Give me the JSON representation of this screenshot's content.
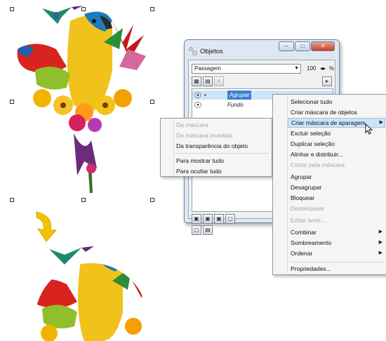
{
  "docker": {
    "title": "Objetos",
    "page_select": "Passagem",
    "opacity": "100",
    "percent": "%",
    "layers": [
      {
        "name": "Agrupar",
        "selected": true
      },
      {
        "name": "Fundo",
        "selected": false
      }
    ]
  },
  "context_menu": {
    "items": [
      {
        "label": "Selecionar tudo",
        "disabled": false
      },
      {
        "label": "Criar máscara de objetos",
        "disabled": false
      },
      {
        "label": "Criar máscara de aparagem",
        "disabled": false,
        "highlighted": true,
        "submenu": true
      },
      {
        "label": "Excluir seleção",
        "disabled": false
      },
      {
        "label": "Duplicar seleção",
        "disabled": false
      },
      {
        "label": "Alinhar e distribuir...",
        "disabled": false
      },
      {
        "label": "Cortar pela máscara",
        "disabled": true
      },
      {
        "label": "Agrupar",
        "disabled": false
      },
      {
        "label": "Desagrupar",
        "disabled": false
      },
      {
        "label": "Bloquear",
        "disabled": false
      },
      {
        "label": "Desbloquear",
        "disabled": true
      },
      {
        "label": "Editar lente...",
        "disabled": true
      },
      {
        "label": "Combinar",
        "disabled": false,
        "submenu": true
      },
      {
        "label": "Sombreamento",
        "disabled": false,
        "submenu": true
      },
      {
        "label": "Ordenar",
        "disabled": false,
        "submenu": true
      },
      {
        "label": "Propriedades...",
        "disabled": false
      }
    ]
  },
  "submenu": {
    "items": [
      {
        "label": "Da máscara",
        "disabled": true
      },
      {
        "label": "Da máscara invertida",
        "disabled": true
      },
      {
        "label": "Da transparência do objeto",
        "disabled": false
      },
      {
        "label": "Para mostrar tudo",
        "disabled": false
      },
      {
        "label": "Para ocultar tudo",
        "disabled": false
      }
    ]
  },
  "icons": {
    "eye": "eye-icon",
    "submenu_arrow": "chevron-right-icon",
    "down_arrow": "curved-down-arrow-icon",
    "cursor": "mouse-pointer-icon"
  },
  "colors": {
    "highlight": "#cde3f7",
    "selected_layer": "#3f7fd1",
    "arrow": "#f2c200"
  }
}
